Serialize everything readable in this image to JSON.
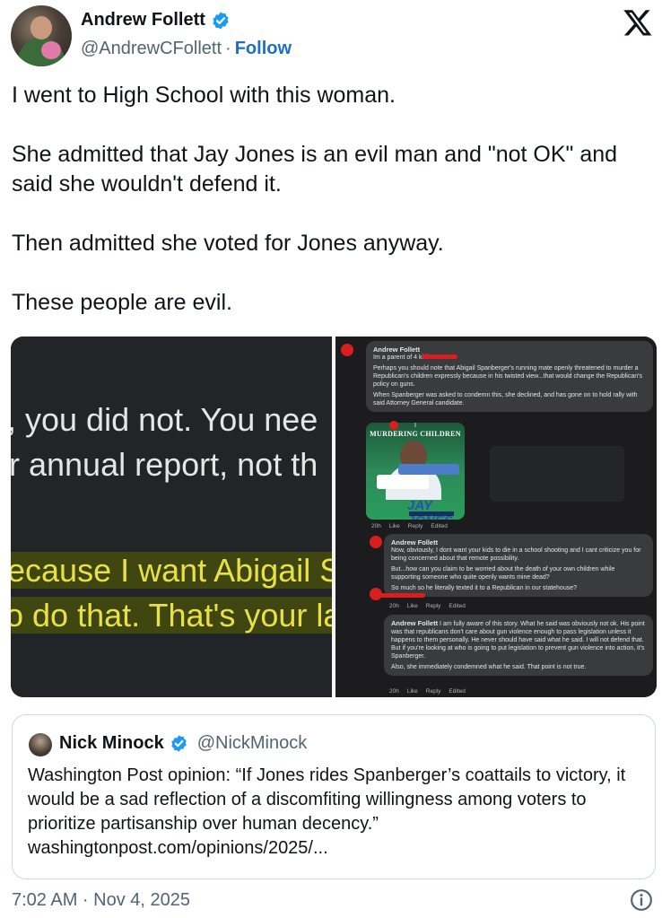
{
  "author": {
    "name": "Andrew Follett",
    "handle": "@AndrewCFollett",
    "separator": "·",
    "follow_label": "Follow"
  },
  "tweet": {
    "paragraphs": [
      "I went to High School with this woman.",
      "She admitted that Jay Jones is an evil man and \"not OK\" and said she wouldn't defend it.",
      "Then admitted she voted for Jones anyway.",
      "These people are evil."
    ]
  },
  "media_left": {
    "lines": [
      ", you did not. You nee",
      "r annual report, not th",
      "ecause I want Abigail S",
      "o do that. That's your la"
    ]
  },
  "media_right": {
    "comment1": {
      "name": "Andrew Follett",
      "line1": "Im a parent of 4 kids",
      "para1": "Perhaps you should note that Abigail Spanberger's running mate openly threatened to murder a Republican's children expressly because in his twisted view...that would change the Republican's policy on guns.",
      "para2": "When Spanberger was asked to condemn this, she declined, and has gone on to hold rally with said Attorney General candidate."
    },
    "image": {
      "top_text": "I",
      "title": "MURDERING CHILDREN",
      "logo": "JAY JONES"
    },
    "meta1": {
      "time": "20h",
      "like": "Like",
      "reply": "Reply",
      "edited": "Edited"
    },
    "comment2": {
      "name": "Andrew Follett",
      "para1": "Now, obviously, I dont want your kids to die in a school shooting and I cant criticize you for being concerned about that remote possibility.",
      "para2": "But...how can you claim to be worried about the death of your own children while supporting someone who quite openly wants mine dead?",
      "para3": "So much so he literally texted it to a Republican in our statehouse?"
    },
    "meta2": {
      "time": "20h",
      "like": "Like",
      "reply": "Reply",
      "edited": "Edited"
    },
    "comment3": {
      "name": "Andrew Follett",
      "para1": "I am fully aware of this story. What he said was obviously not ok. His point was that republicans don't care about gun violence enough to pass legislation unless it happens to them personally. He never should have said what he said. I will not defend that. But if you're looking at who is going to put legislation to prevent gun violence into action, it's Spanberger.",
      "para2": "Also, she immediately condemned what he said. That point is not true."
    },
    "meta3": {
      "time": "20h",
      "like": "Like",
      "reply": "Reply",
      "edited": "Edited"
    }
  },
  "quote": {
    "name": "Nick Minock",
    "handle": "@NickMinock",
    "text": "Washington Post opinion: “If Jones rides Spanberger’s coattails to victory, it would be a sad reflection of a discomfiting willingness among voters to prioritize partisanship over human decency.”",
    "link": "washingtonpost.com/opinions/2025/..."
  },
  "footer": {
    "timestamp": "7:02 AM · Nov 4, 2025"
  },
  "icons": {
    "verified": "verified-badge-icon",
    "x_logo": "x-logo-icon",
    "info": "info-icon"
  },
  "colors": {
    "verified_blue": "#1d9bf0",
    "follow_blue": "#1d6fc4",
    "highlight_yellow": "#e8e04a",
    "red_redaction": "#d81e1e"
  }
}
